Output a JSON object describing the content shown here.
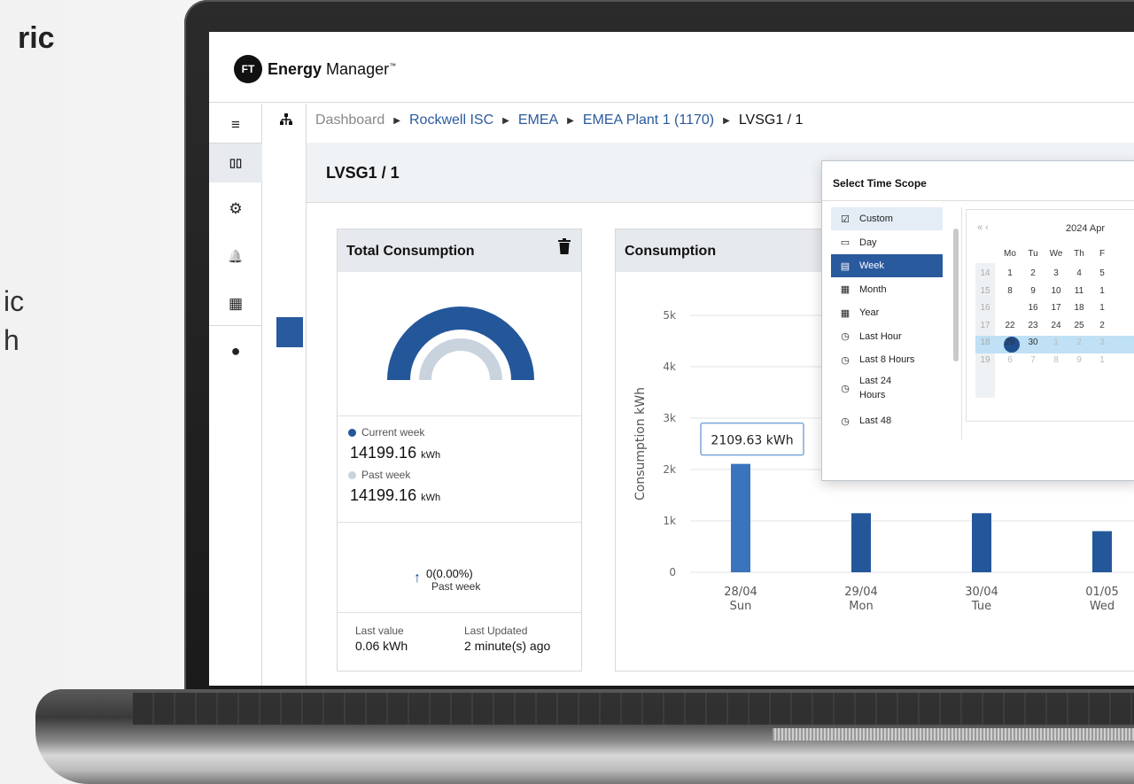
{
  "marketing": {
    "title_fragment": "ric",
    "line1_fragment": "ic",
    "line2_fragment": "h"
  },
  "app": {
    "logo_badge": "FT",
    "logo_name_bold": "Energy",
    "logo_name_rest": "Manager",
    "logo_tm": "™"
  },
  "rail": {
    "items": [
      {
        "icon": "menu-icon",
        "glyph": "≡"
      },
      {
        "icon": "dashboard-icon",
        "glyph": "▯▯"
      },
      {
        "icon": "gear-icon",
        "glyph": "⚙"
      },
      {
        "icon": "bell-icon",
        "glyph": "🔔"
      },
      {
        "icon": "report-icon",
        "glyph": "▦"
      },
      {
        "icon": "ft-logo-icon",
        "glyph": "●"
      }
    ]
  },
  "breadcrumb": {
    "items": [
      "Dashboard",
      "Rockwell ISC",
      "EMEA",
      "EMEA Plant 1 (1170)",
      "LVSG1 / 1"
    ]
  },
  "page": {
    "title": "LVSG1 / 1"
  },
  "total_card": {
    "title": "Total Consumption",
    "gauge_current_fraction": 1.0,
    "gauge_past_fraction": 1.0,
    "current_label": "Current week",
    "current_value": "14199.16",
    "current_unit": "kWh",
    "past_label": "Past week",
    "past_value": "14199.16",
    "past_unit": "kWh",
    "delta_value": "0(0.00%)",
    "delta_label": "Past week",
    "last_value_label": "Last value",
    "last_value": "0.06 kWh",
    "last_updated_label": "Last Updated",
    "last_updated": "2 minute(s) ago",
    "colors": {
      "current": "#24579a",
      "past": "#c9d3dd"
    }
  },
  "consumption_card": {
    "title": "Consumption"
  },
  "chart_data": {
    "type": "bar",
    "ylabel": "Consumption kWh",
    "ylim": [
      0,
      5000
    ],
    "yticks": [
      "0",
      "1k",
      "2k",
      "3k",
      "4k",
      "5k"
    ],
    "categories": [
      "28/04",
      "29/04",
      "30/04",
      "01/05"
    ],
    "category_days": [
      "Sun",
      "Mon",
      "Tue",
      "Wed"
    ],
    "values": [
      2109.63,
      1150,
      1150,
      800
    ],
    "tooltip": "2109.63 kWh",
    "colors": {
      "bar": "#24579a",
      "highlight": "#3a74bd"
    }
  },
  "time_scope": {
    "title": "Select Time Scope",
    "options": [
      {
        "label": "Custom",
        "icon": "calendar-check-icon",
        "state": "hover"
      },
      {
        "label": "Day",
        "icon": "calendar-day-icon",
        "state": ""
      },
      {
        "label": "Week",
        "icon": "calendar-week-icon",
        "state": "selected"
      },
      {
        "label": "Month",
        "icon": "calendar-month-icon",
        "state": ""
      },
      {
        "label": "Year",
        "icon": "calendar-year-icon",
        "state": ""
      },
      {
        "label": "Last Hour",
        "icon": "clock-icon",
        "state": ""
      },
      {
        "label": "Last 8 Hours",
        "icon": "clock-icon",
        "state": ""
      },
      {
        "label": "Last 24 Hours",
        "icon": "clock-icon",
        "state": ""
      },
      {
        "label": "Last 48",
        "icon": "clock-icon",
        "state": ""
      }
    ],
    "calendar": {
      "nav_prev": "« ‹",
      "title": "2024 Apr",
      "weekdays": [
        "Mo",
        "Tu",
        "We",
        "Th",
        "F"
      ],
      "weeks": [
        {
          "wk": "14",
          "days": [
            "1",
            "2",
            "3",
            "4",
            "5"
          ]
        },
        {
          "wk": "15",
          "days": [
            "8",
            "9",
            "10",
            "11",
            "1"
          ]
        },
        {
          "wk": "16",
          "days": [
            "15",
            "16",
            "17",
            "18",
            "1"
          ]
        },
        {
          "wk": "17",
          "days": [
            "22",
            "23",
            "24",
            "25",
            "2"
          ]
        },
        {
          "wk": "18",
          "days": [
            "29",
            "30",
            "1",
            "2",
            "3"
          ]
        },
        {
          "wk": "19",
          "days": [
            "6",
            "7",
            "8",
            "9",
            "1"
          ]
        }
      ]
    }
  }
}
